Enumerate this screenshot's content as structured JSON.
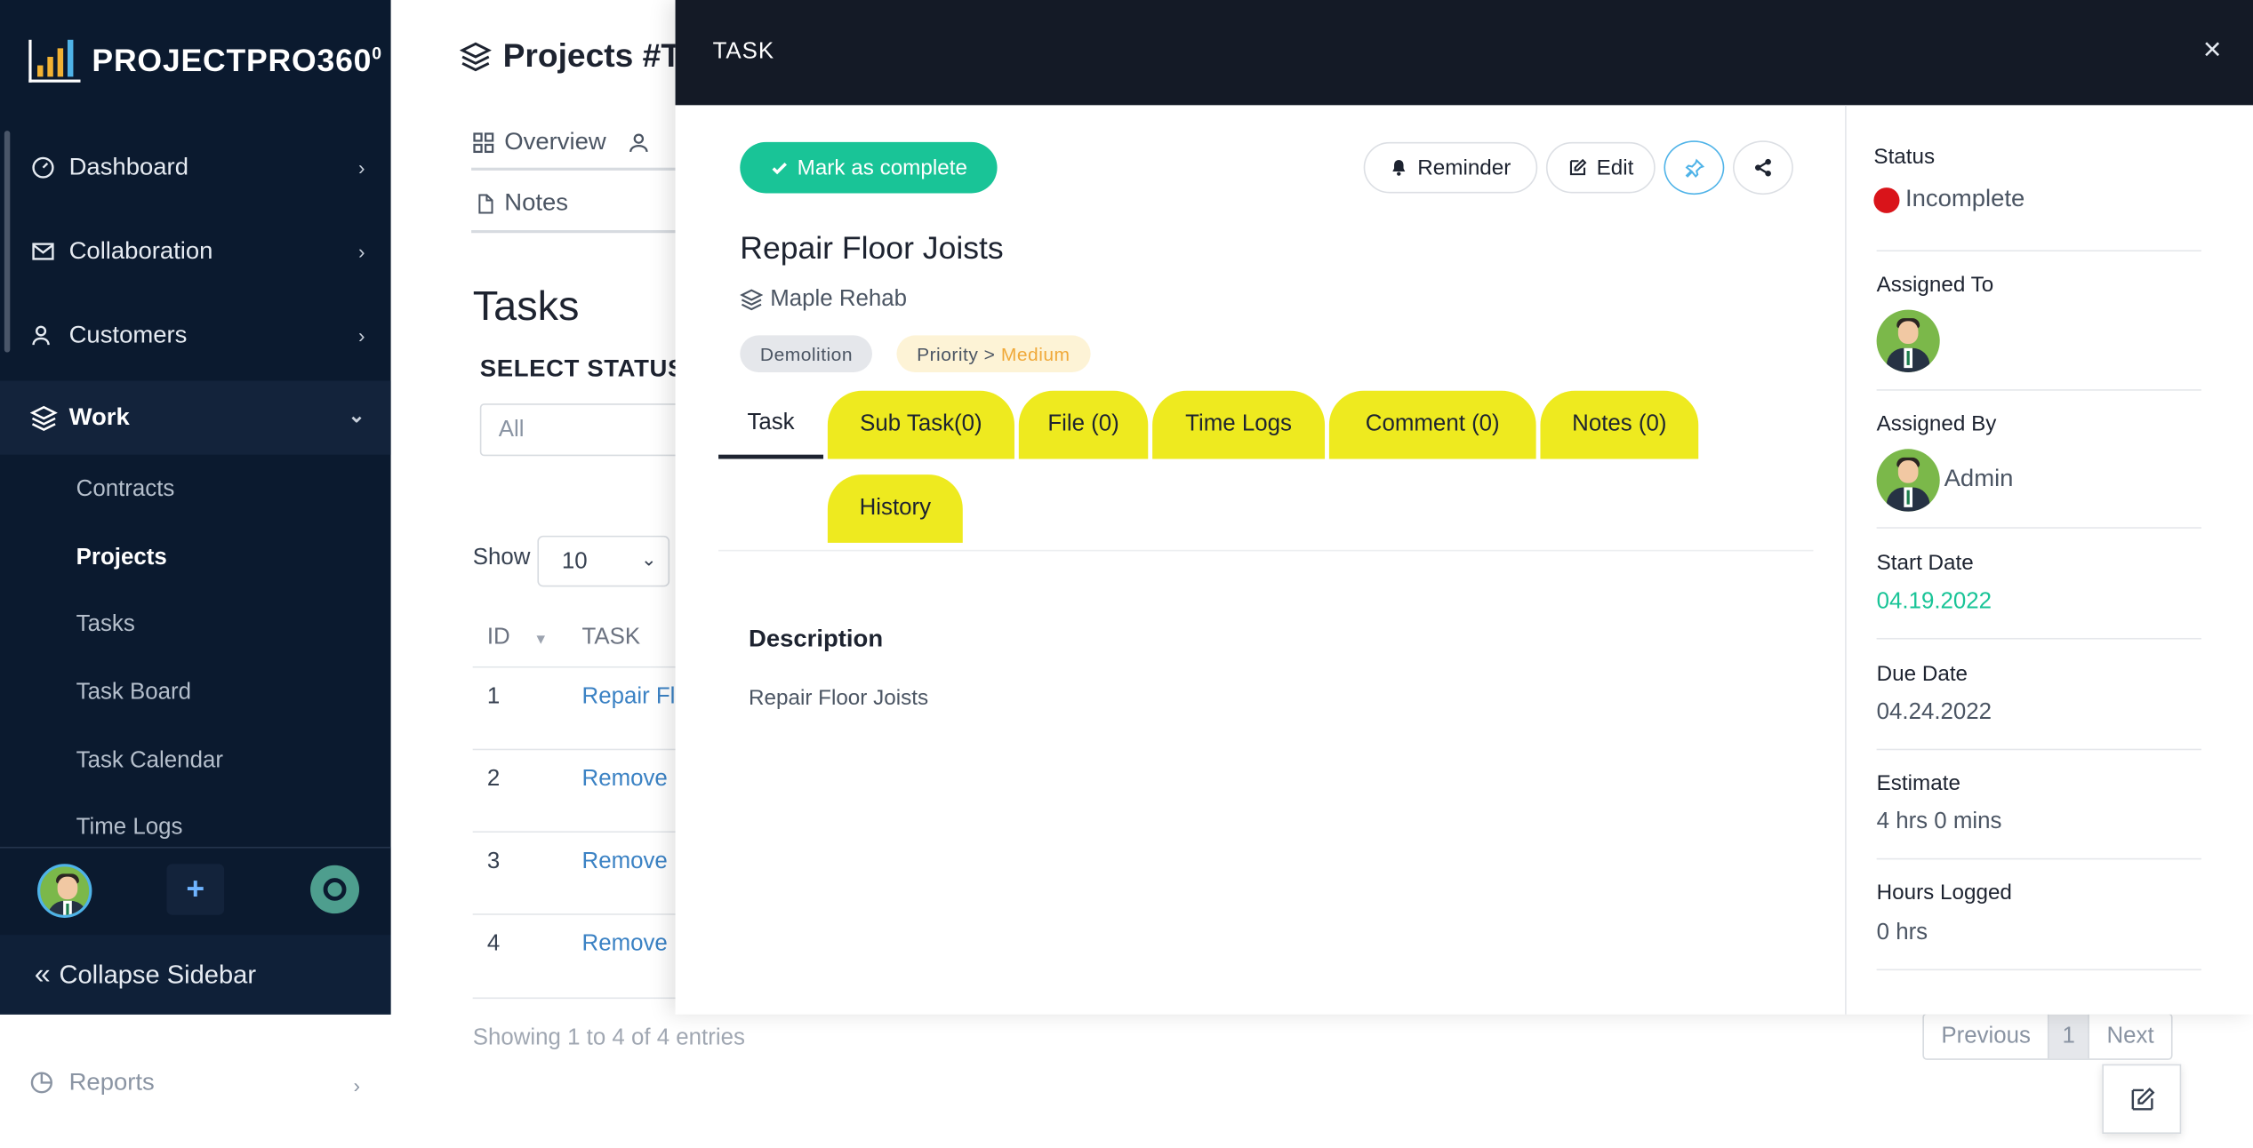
{
  "brand": {
    "name": "PROJECTPRO360",
    "sup": "0"
  },
  "sidebar": {
    "items": [
      {
        "label": "Dashboard"
      },
      {
        "label": "Collaboration"
      },
      {
        "label": "Customers"
      },
      {
        "label": "Work"
      }
    ],
    "work_sub": [
      "Contracts",
      "Projects",
      "Tasks",
      "Task Board",
      "Task Calendar",
      "Time Logs"
    ],
    "collapse_label": "Collapse Sidebar",
    "reports_label": "Reports"
  },
  "page": {
    "title": "Projects #T",
    "tabs": {
      "overview": "Overview",
      "notes": "Notes"
    },
    "heading": "Tasks",
    "select_status_label": "SELECT STATUS",
    "status_filter_value": "All",
    "show_label": "Show",
    "page_length": "10",
    "columns": {
      "id": "ID",
      "task": "TASK"
    },
    "rows": [
      {
        "id": "1",
        "task": "Repair Fl"
      },
      {
        "id": "2",
        "task": "Remove"
      },
      {
        "id": "3",
        "task": "Remove"
      },
      {
        "id": "4",
        "task": "Remove"
      }
    ],
    "info": "Showing 1 to 4 of 4 entries",
    "pager": {
      "prev": "Previous",
      "current": "1",
      "next": "Next"
    }
  },
  "modal": {
    "header_title": "TASK",
    "close_glyph": "×",
    "mark_complete_label": "Mark as complete",
    "reminder_label": "Reminder",
    "edit_label": "Edit",
    "task_title": "Repair Floor Joists",
    "project_name": "Maple Rehab",
    "category_tag": "Demolition",
    "priority_label": "Priority >",
    "priority_value": "Medium",
    "tabs": [
      "Task",
      "Sub Task(0)",
      "File (0)",
      "Time Logs",
      "Comment (0)",
      "Notes (0)",
      "History"
    ],
    "description_heading": "Description",
    "description_text": "Repair Floor Joists",
    "info": {
      "status_label": "Status",
      "status_value": "Incomplete",
      "assigned_to_label": "Assigned To",
      "assigned_by_label": "Assigned By",
      "assigned_by_name": "Admin",
      "start_date_label": "Start Date",
      "start_date": "04.19.2022",
      "due_date_label": "Due Date",
      "due_date": "04.24.2022",
      "estimate_label": "Estimate",
      "estimate": "4 hrs 0 mins",
      "hours_logged_label": "Hours Logged",
      "hours_logged": "0 hrs"
    }
  },
  "colors": {
    "sidebar_bg": "#0b1a2f",
    "modal_header": "#141a26",
    "complete_button": "#19c497",
    "tab_yellow": "#eeea1f",
    "status_incomplete": "#d9141a",
    "start_date": "#19c497",
    "priority_medium": "#f0a93a"
  },
  "icons": [
    "dashboard-icon",
    "envelope-icon",
    "user-icon",
    "layers-icon",
    "bell-icon",
    "edit-icon",
    "pin-icon",
    "share-icon",
    "check-icon",
    "close-icon",
    "chevron-icon",
    "pie-icon",
    "plus-icon",
    "notification-icon"
  ]
}
